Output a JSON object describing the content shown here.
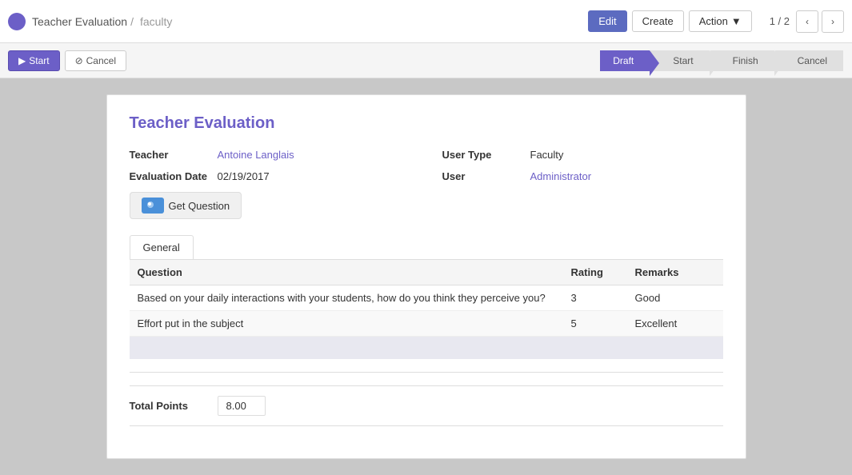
{
  "topbar": {
    "breadcrumb_part1": "Teacher Evaluation",
    "breadcrumb_separator": "/",
    "breadcrumb_part2": "faculty",
    "btn_edit": "Edit",
    "btn_create": "Create",
    "btn_action": "Action",
    "pagination": "1 / 2"
  },
  "workflow": {
    "btn_start": "Start",
    "btn_cancel": "Cancel",
    "steps": [
      {
        "label": "Draft",
        "active": true
      },
      {
        "label": "Start",
        "active": false
      },
      {
        "label": "Finish",
        "active": false
      },
      {
        "label": "Cancel",
        "active": false
      }
    ]
  },
  "form": {
    "title": "Teacher Evaluation",
    "teacher_label": "Teacher",
    "teacher_value": "Antoine Langlais",
    "eval_date_label": "Evaluation Date",
    "eval_date_value": "02/19/2017",
    "user_type_label": "User Type",
    "user_type_value": "Faculty",
    "user_label": "User",
    "user_value": "Administrator",
    "get_question_btn": "Get Question"
  },
  "tabs": [
    {
      "label": "General",
      "active": true
    }
  ],
  "table": {
    "col_question": "Question",
    "col_rating": "Rating",
    "col_remarks": "Remarks",
    "rows": [
      {
        "question": "Based on your daily interactions with your students, how do you think they perceive you?",
        "rating": "3",
        "remarks": "Good"
      },
      {
        "question": "Effort put in the subject",
        "rating": "5",
        "remarks": "Excellent"
      }
    ]
  },
  "total": {
    "label": "Total Points",
    "value": "8.00"
  }
}
